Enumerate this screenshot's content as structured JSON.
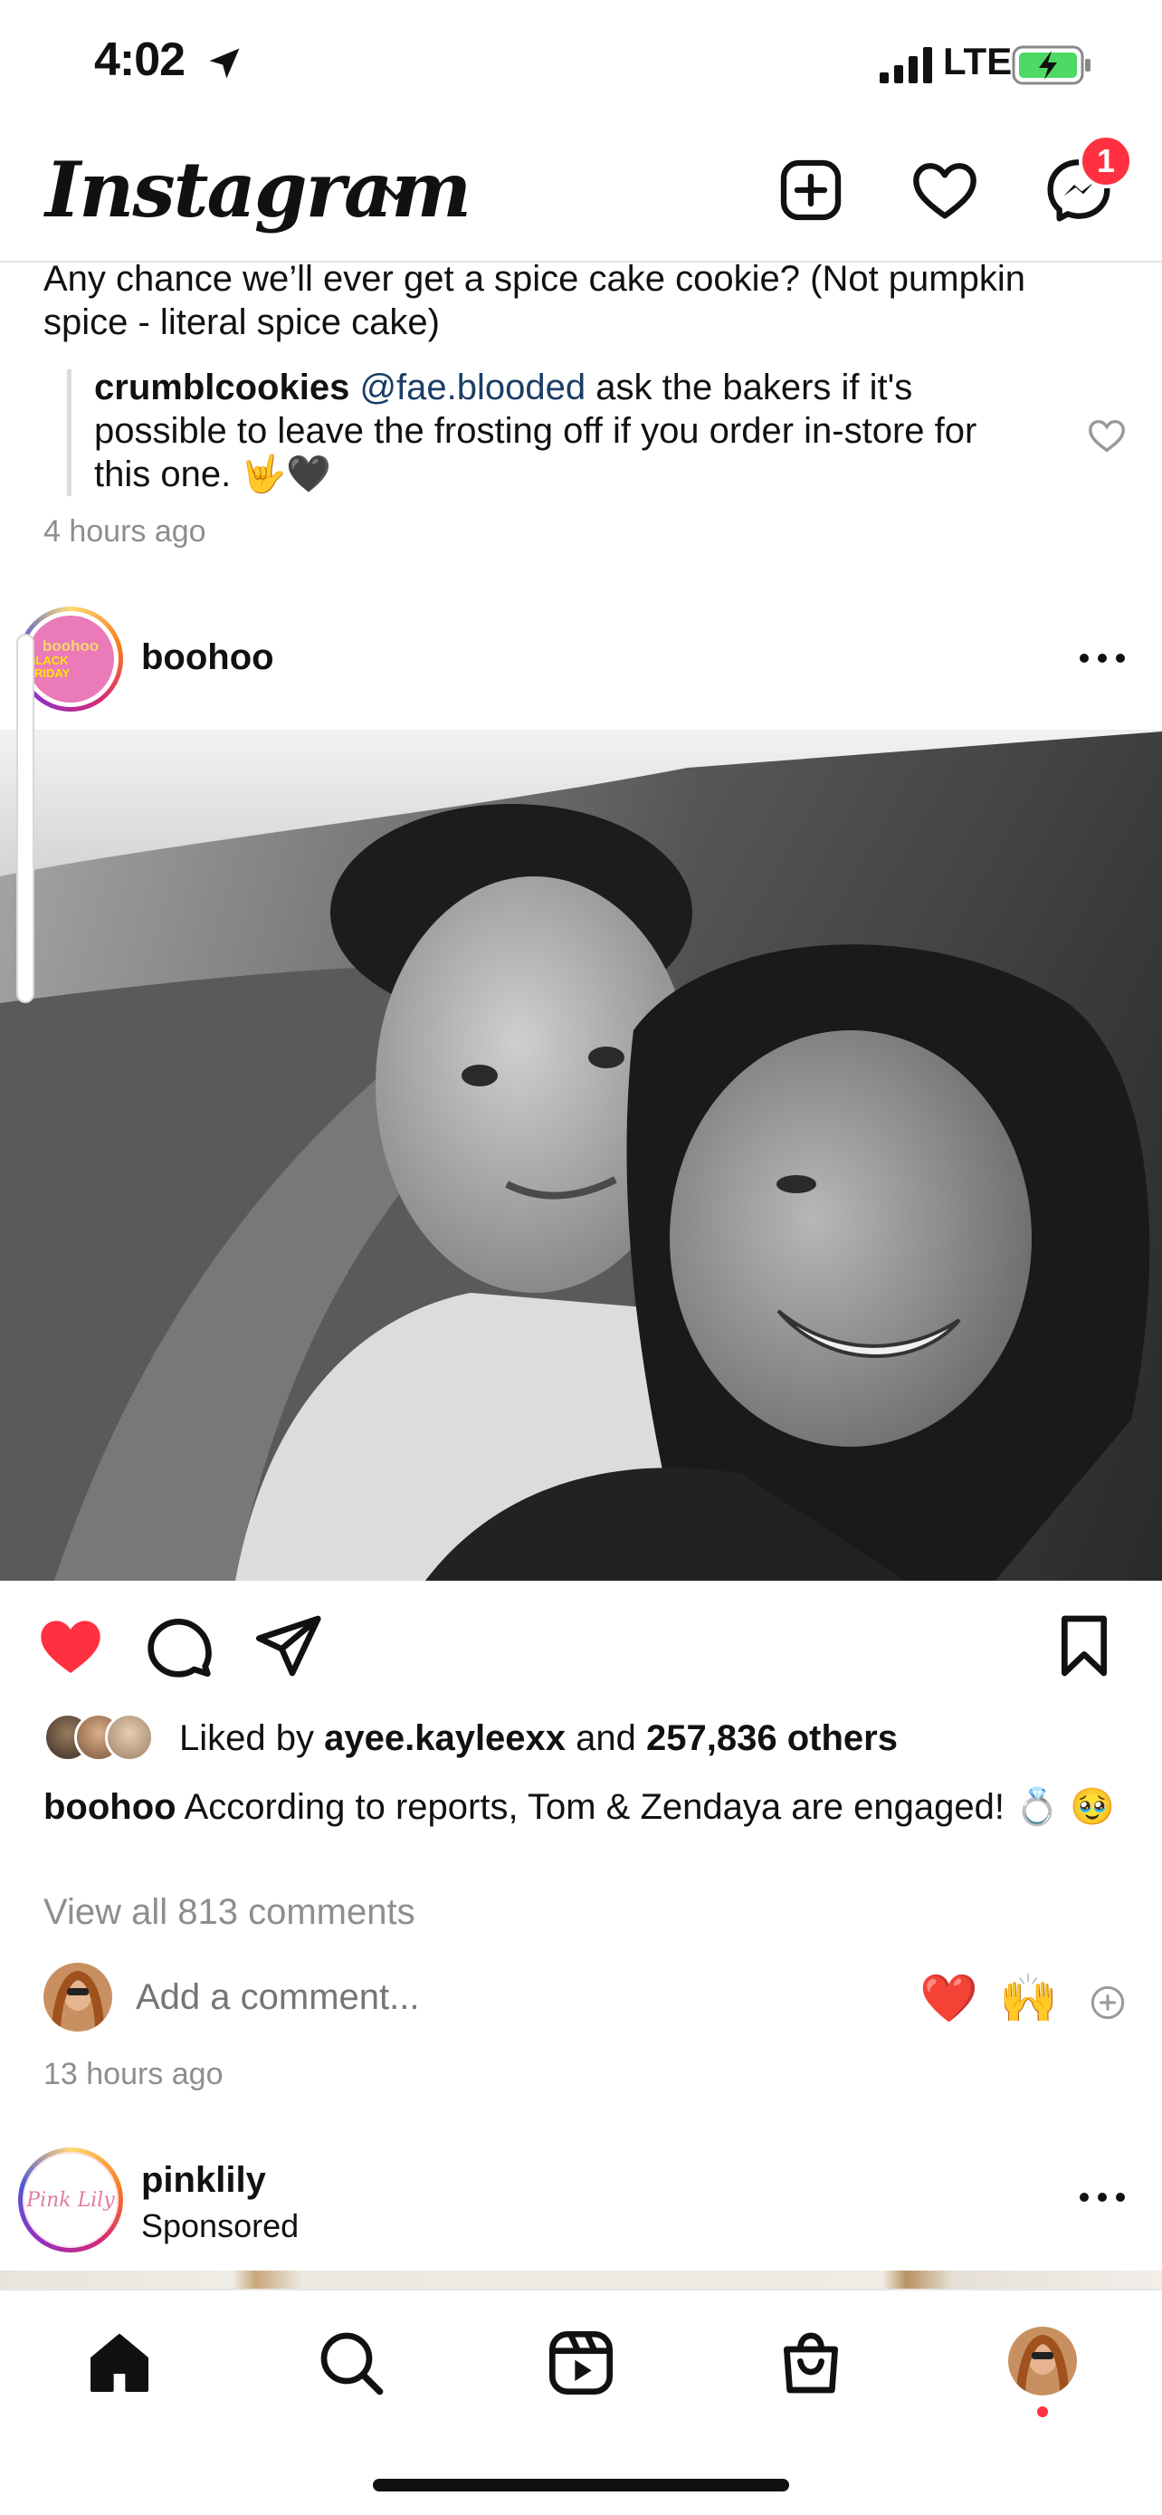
{
  "status_bar": {
    "time": "4:02",
    "network": "LTE",
    "location_icon": "location-arrow-icon",
    "battery_icon": "battery-charging-icon",
    "battery_color": "#4cd964"
  },
  "header": {
    "logo": "Instagram",
    "new_post_icon": "plus-square-icon",
    "activity_icon": "heart-outline-icon",
    "messenger_icon": "messenger-icon",
    "messenger_badge": "1",
    "badge_color": "#ff3040"
  },
  "previous_post": {
    "comment_text": "Any chance we’ll ever get a spice cake cookie? (Not pumpkin spice - literal spice cake)",
    "reply": {
      "user": "crumblcookies",
      "mention": "@fae.blooded",
      "text": " ask the bakers if it's possible to leave the frosting off if you order in-store for this one. 🤟🖤"
    },
    "time": "4 hours ago"
  },
  "post": {
    "username": "boohoo",
    "avatar_text_1": "boohoo",
    "avatar_text_2": "BLACK FRIDAY",
    "liked": true,
    "like_color": "#ff3040",
    "likes": {
      "prefix": "Liked by ",
      "user": "ayee.kayleexx",
      "middle": " and ",
      "others": "257,836 others"
    },
    "caption": {
      "user": "boohoo",
      "text": " According to reports, Tom & Zendaya are engaged! 💍 🥹"
    },
    "view_comments": "View all 813 comments",
    "add_comment_placeholder": "Add a comment...",
    "quick_reactions": [
      "❤️",
      "🙌"
    ],
    "time": "13 hours ago"
  },
  "next_post": {
    "username": "pinklily",
    "sponsored": "Sponsored",
    "avatar_text": "Pink Lily"
  },
  "bottom_nav": {
    "items": [
      "home-icon",
      "search-icon",
      "reels-icon",
      "shop-icon",
      "profile-avatar"
    ]
  }
}
